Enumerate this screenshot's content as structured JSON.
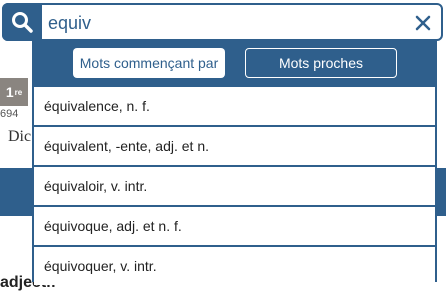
{
  "background": {
    "badge_main": "1",
    "badge_sup": "re",
    "number": "694",
    "text_fragment": "Dic",
    "bottom_fragment": "adjectif"
  },
  "search": {
    "value": "equiv",
    "button_icon": "search-icon",
    "clear_icon": "close-icon"
  },
  "tabs": [
    {
      "label": "Mots commençant par",
      "active": true
    },
    {
      "label": "Mots proches",
      "active": false
    }
  ],
  "results": [
    "équivalence, n. f.",
    "équivalent, -ente, adj. et n.",
    "équivaloir, v. intr.",
    "équivoque, adj. et n. f.",
    "équivoquer, v. intr."
  ],
  "colors": {
    "primary": "#2f5f8c",
    "badge": "#8a8580"
  }
}
